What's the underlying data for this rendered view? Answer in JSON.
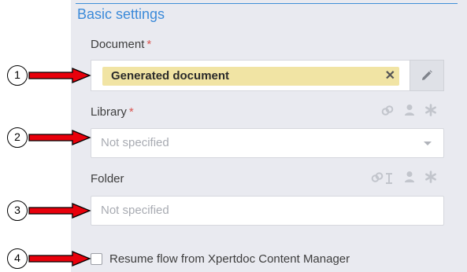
{
  "section": {
    "title": "Basic settings"
  },
  "document": {
    "label": "Document",
    "required_mark": "*",
    "chip_label": "Generated document",
    "chip_remove": "✕"
  },
  "library": {
    "label": "Library",
    "required_mark": "*",
    "placeholder": "Not specified"
  },
  "folder": {
    "label": "Folder",
    "placeholder": "Not specified"
  },
  "resume_flow": {
    "label": "Resume flow from Xpertdoc Content Manager",
    "checked": false
  },
  "callouts": [
    "1",
    "2",
    "3",
    "4"
  ],
  "icons": {
    "edit": "pencil-icon",
    "link": "link-icon",
    "user": "user-icon",
    "asterisk": "asterisk-icon",
    "caret": "caret-down-icon",
    "remove": "remove-icon"
  },
  "colors": {
    "accent": "#3b8ad9",
    "chip": "#f1e4a4",
    "required": "#d9534f",
    "arrow": "#e8000b",
    "panel": "#e9eaf0"
  }
}
